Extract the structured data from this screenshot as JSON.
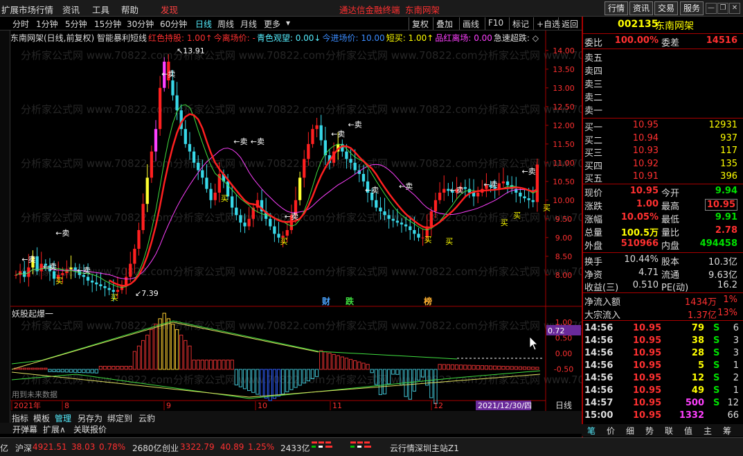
{
  "topbar": {
    "menu": [
      "扩展市场行情",
      "资讯",
      "工具",
      "帮助"
    ],
    "hot": "发现",
    "center_title": "通达信金融终端",
    "center_stock": "东南网架",
    "buttons": [
      "行情",
      "资讯",
      "交易",
      "服务"
    ]
  },
  "periods": [
    "分时",
    "1分钟",
    "5分钟",
    "15分钟",
    "30分钟",
    "60分钟",
    "日线",
    "周线",
    "月线",
    "更多"
  ],
  "selected_period": "日线",
  "toolbar_right": [
    "复权",
    "叠加",
    "画线",
    "F10",
    "标记",
    "+自选",
    "返回"
  ],
  "legend": [
    {
      "t": "东南网架(日线,前复权) 智能暴利短线",
      "c": "#dddddd"
    },
    {
      "t": "红色持股: 1.00↑",
      "c": "#ff3030"
    },
    {
      "t": "今离场价: -",
      "c": "#ff3030"
    },
    {
      "t": "青色观望: 0.00↓",
      "c": "#55eeff"
    },
    {
      "t": "今进场价: 10.00",
      "c": "#3b8cff"
    },
    {
      "t": "短买: 1.00↑",
      "c": "#ffff00"
    },
    {
      "t": "品红离场: 0.00",
      "c": "#ff40ff"
    },
    {
      "t": "急速超跌: ◇",
      "c": "#dddddd"
    }
  ],
  "price_axis": [
    "14.00",
    "13.50",
    "13.00",
    "12.50",
    "12.00",
    "11.50",
    "11.00",
    "10.50",
    "10.00",
    "9.50",
    "9.00",
    "8.50",
    "8.00"
  ],
  "max_label": "13.91",
  "min_label": "7.39",
  "sell_label": "←卖",
  "buy_label": "买",
  "event_tags": [
    "财",
    "跌",
    "榜"
  ],
  "indicator": {
    "name": "妖股起爆一",
    "axis": [
      "1.00",
      "0.50",
      "0.00",
      "-0.50"
    ],
    "current": "0.72",
    "note": "用到未来数据"
  },
  "date_axis": [
    "2021年",
    "8",
    "9",
    "10",
    "11",
    "12"
  ],
  "cursor_date": "2021/12/30/四",
  "period_indicator": "日线",
  "zoom_controls": [
    "+",
    "-",
    "0"
  ],
  "bottom_tabs1": [
    "指标",
    "模板",
    "管理",
    "另存为",
    "绑定到",
    "云豹"
  ],
  "bottom_tabs2": [
    "开弹幕",
    "扩展∧",
    "关联报价"
  ],
  "quote": {
    "code": "002135",
    "name": "东南网架",
    "weibi_label": "委比",
    "weibi": "100.00%",
    "weicha_label": "委差",
    "weicha": "14516",
    "sells": [
      "卖五",
      "卖四",
      "卖三",
      "卖二",
      "卖一"
    ],
    "buys": [
      {
        "l": "买一",
        "p": "10.95",
        "v": "12931"
      },
      {
        "l": "买二",
        "p": "10.94",
        "v": "937"
      },
      {
        "l": "买三",
        "p": "10.93",
        "v": "117"
      },
      {
        "l": "买四",
        "p": "10.92",
        "v": "135"
      },
      {
        "l": "买五",
        "p": "10.91",
        "v": "396"
      }
    ],
    "stats": [
      {
        "l1": "现价",
        "v1": "10.95",
        "c1": "red",
        "l2": "今开",
        "v2": "9.94",
        "c2": "grn"
      },
      {
        "l1": "涨跌",
        "v1": "1.00",
        "c1": "red",
        "l2": "最高",
        "v2": "10.95",
        "c2": "red"
      },
      {
        "l1": "涨幅",
        "v1": "10.05%",
        "c1": "red",
        "l2": "最低",
        "v2": "9.91",
        "c2": "grn"
      },
      {
        "l1": "总量",
        "v1": "100.5万",
        "c1": "yel",
        "l2": "量比",
        "v2": "2.78",
        "c2": "red"
      },
      {
        "l1": "外盘",
        "v1": "510966",
        "c1": "red",
        "l2": "内盘",
        "v2": "494458",
        "c2": "grn"
      }
    ],
    "stats2": [
      {
        "l1": "换手",
        "v1": "10.44%",
        "c1": "wht",
        "l2": "股本",
        "v2": "10.3亿",
        "c2": "wht"
      },
      {
        "l1": "净资",
        "v1": "4.71",
        "c1": "wht",
        "l2": "流通",
        "v2": "9.63亿",
        "c2": "wht"
      },
      {
        "l1": "收益(三)",
        "v1": "0.510",
        "c1": "wht",
        "l2": "PE(动)",
        "v2": "16.2",
        "c2": "wht"
      }
    ],
    "flows": [
      {
        "l": "净流入额",
        "v": "1434万",
        "p": "1%"
      },
      {
        "l": "大宗流入",
        "v": "1.37亿",
        "p": "13%"
      }
    ],
    "ticks": [
      {
        "t": "14:56",
        "p": "10.95",
        "v": "79",
        "s": "S",
        "n": "6",
        "vc": "yel"
      },
      {
        "t": "14:56",
        "p": "10.95",
        "v": "38",
        "s": "S",
        "n": "3",
        "vc": "yel"
      },
      {
        "t": "14:56",
        "p": "10.95",
        "v": "28",
        "s": "S",
        "n": "3",
        "vc": "yel"
      },
      {
        "t": "14:56",
        "p": "10.95",
        "v": "5",
        "s": "S",
        "n": "1",
        "vc": "yel"
      },
      {
        "t": "14:56",
        "p": "10.95",
        "v": "12",
        "s": "S",
        "n": "2",
        "vc": "yel"
      },
      {
        "t": "14:56",
        "p": "10.95",
        "v": "49",
        "s": "S",
        "n": "1",
        "vc": "yel"
      },
      {
        "t": "14:57",
        "p": "10.95",
        "v": "500",
        "s": "S",
        "n": "12",
        "vc": "mag"
      },
      {
        "t": "15:00",
        "p": "10.95",
        "v": "1332",
        "s": "",
        "n": "66",
        "vc": "mag"
      }
    ]
  },
  "right_tabs": [
    "笔",
    "价",
    "细",
    "势",
    "联",
    "值",
    "主",
    "筹"
  ],
  "status": {
    "i1": "亿",
    "sh_label": "沪深",
    "sh_val": "4921.51",
    "sh_chg": "38.03",
    "sh_pct": "0.78%",
    "sh_amt": "2680亿",
    "cy_label": "创业",
    "cy_val": "3322.79",
    "cy_chg": "40.89",
    "cy_pct": "1.25%",
    "cy_amt": "2433亿",
    "server": "云行情深圳主站Z1"
  },
  "watermark": "分析家公式网 www.70822.com"
}
